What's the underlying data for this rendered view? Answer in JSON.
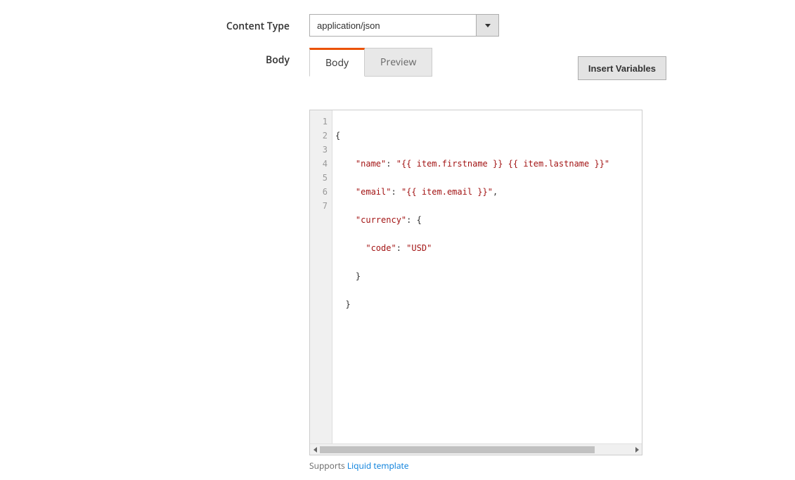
{
  "form": {
    "content_type": {
      "label": "Content Type",
      "value": "application/json"
    },
    "body": {
      "label": "Body",
      "tabs": {
        "body": "Body",
        "preview": "Preview"
      },
      "insert_button": "Insert Variables",
      "helper_prefix": "Supports ",
      "helper_link": "Liquid template",
      "code": {
        "line_numbers": [
          "1",
          "2",
          "3",
          "4",
          "5",
          "6",
          "7"
        ],
        "l1": "{",
        "l2a": "    ",
        "l2b": "\"name\"",
        "l2c": ": ",
        "l2d": "\"{{ item.firstname }} {{ item.lastname }}\"",
        "l3a": "    ",
        "l3b": "\"email\"",
        "l3c": ": ",
        "l3d": "\"{{ item.email }}\"",
        "l3e": ",",
        "l4a": "    ",
        "l4b": "\"currency\"",
        "l4c": ": {",
        "l5a": "      ",
        "l5b": "\"code\"",
        "l5c": ": ",
        "l5d": "\"USD\"",
        "l6": "    }",
        "l7": "  }"
      }
    }
  }
}
